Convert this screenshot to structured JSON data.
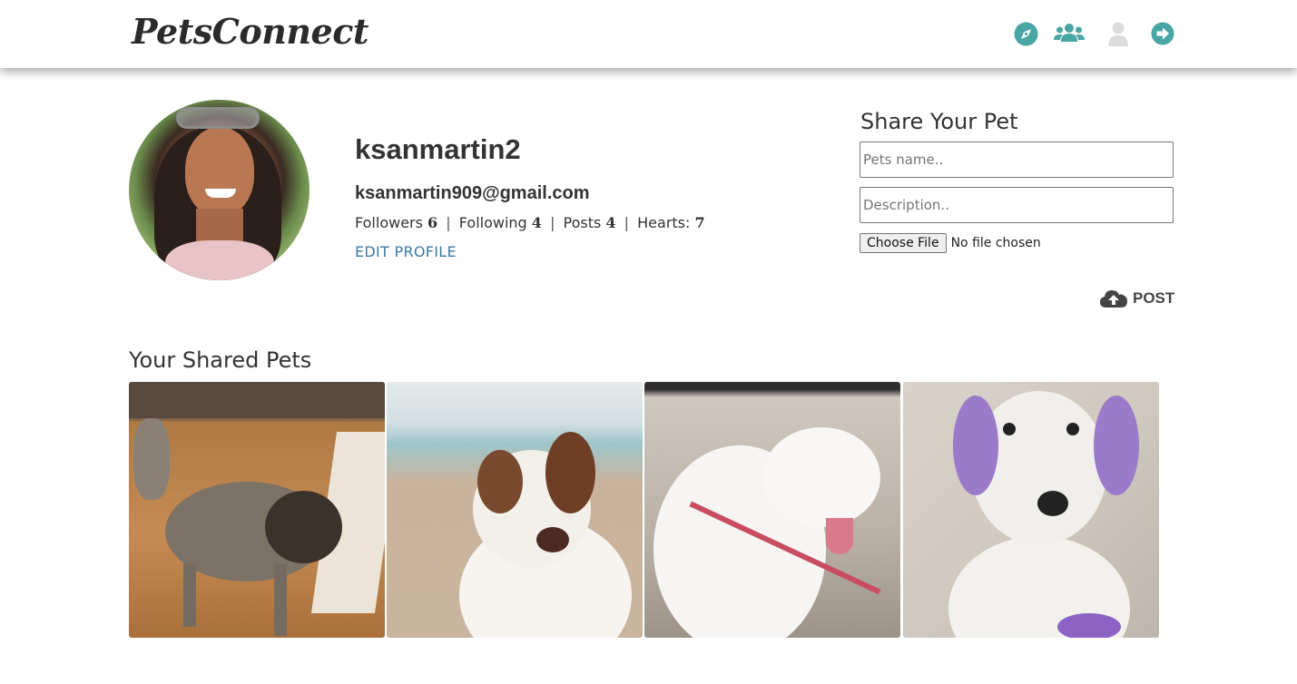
{
  "header": {
    "logo": "PetsConnect",
    "nav_icons": [
      "compass-icon",
      "users-icon",
      "user-icon",
      "sign-out-icon"
    ],
    "colors": {
      "accent": "#4aa5a5",
      "inactive": "#dcdcdc"
    }
  },
  "profile": {
    "username": "ksanmartin2",
    "email": "ksanmartin909@gmail.com",
    "stats": {
      "followers_label": "Followers",
      "followers": "6",
      "following_label": "Following",
      "following": "4",
      "posts_label": "Posts",
      "posts": "4",
      "hearts_label": "Hearts:",
      "hearts": "7",
      "separator": "|"
    },
    "edit_label": "EDIT PROFILE"
  },
  "share": {
    "title": "Share Your Pet",
    "name_placeholder": "Pets name..",
    "description_placeholder": "Description..",
    "file_button": "Choose File",
    "file_status": "No file chosen",
    "post_label": "POST"
  },
  "gallery": {
    "title": "Your Shared Pets",
    "items": [
      "pet-photo-1",
      "pet-photo-2",
      "pet-photo-3",
      "pet-photo-4"
    ]
  }
}
